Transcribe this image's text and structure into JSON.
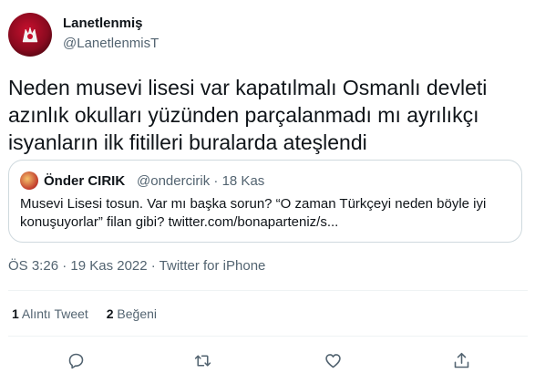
{
  "tweet": {
    "author_name": "Lanetlenmiş",
    "author_handle": "@LanetlenmisT",
    "text": "Neden musevi lisesi var kapatılmalı Osmanlı devleti\nazınlık okulları yüzünden parçalanmadı mı ayrılıkçı\nisyanların ilk fitilleri buralarda ateşlendi",
    "timestamp": "ÖS 3:26 · 19 Kas 2022 · Twitter for iPhone"
  },
  "quote": {
    "author_name": "Önder CIRIK",
    "meta": "@ondercirik · 18 Kas",
    "text": "Musevi Lisesi tosun. Var mı başka sorun? “O zaman Türkçeyi neden böyle iyi\nkonuşuyorlar” filan gibi? twitter.com/bonaparteniz/s..."
  },
  "stats": {
    "quote_count": "1",
    "quote_label": "Alıntı Tweet",
    "like_count": "2",
    "like_label": "Beğeni"
  },
  "actions": {
    "icons": [
      "reply-icon",
      "retweet-icon",
      "like-icon",
      "share-icon"
    ]
  },
  "colors": {
    "text_primary": "#0f1419",
    "text_secondary": "#536471",
    "border": "#cfd9de",
    "divider": "#eff3f4"
  }
}
